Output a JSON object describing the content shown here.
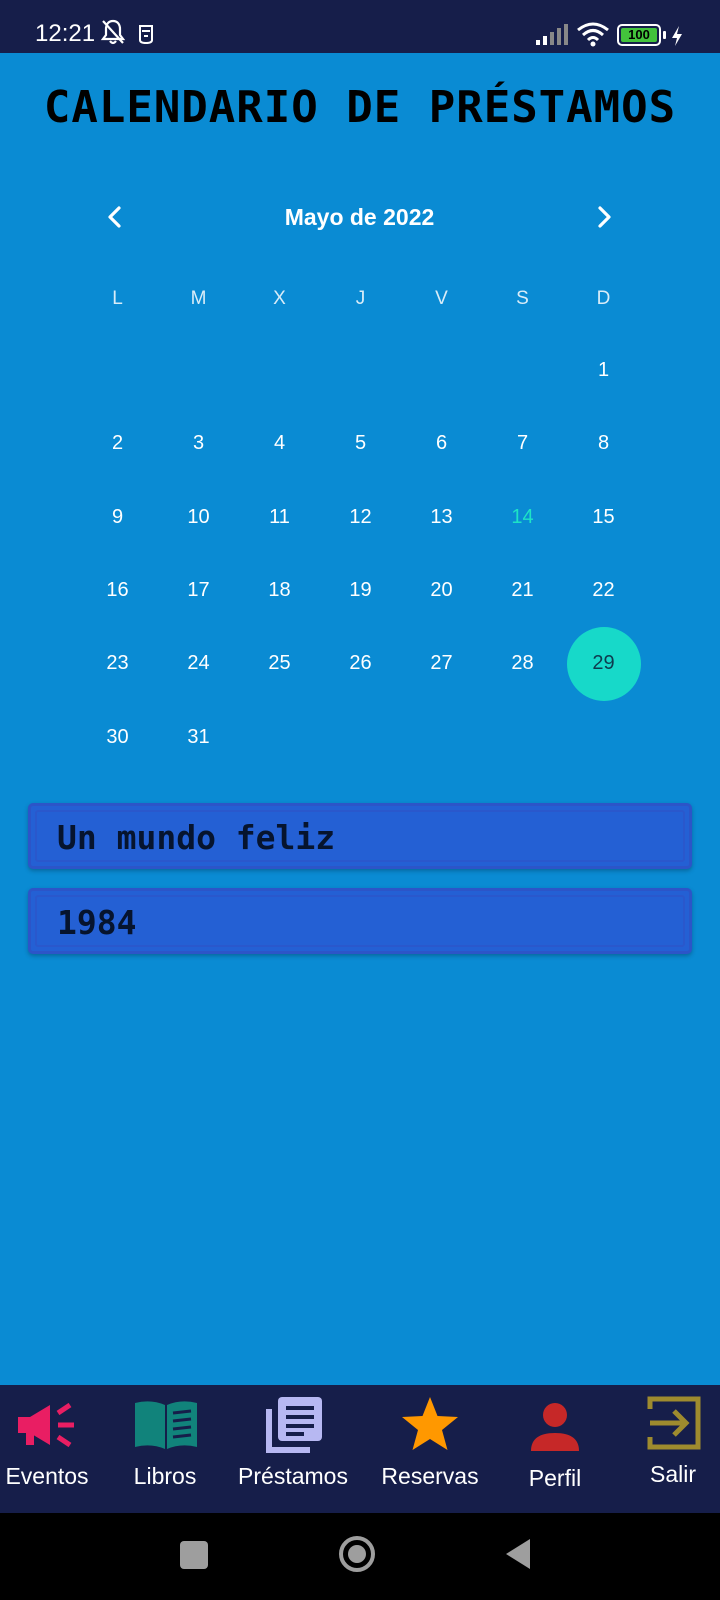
{
  "status_bar": {
    "time": "12:21",
    "battery_level": "100",
    "icons": [
      "bell-off-icon",
      "alarm-icon",
      "signal-icon",
      "wifi-icon",
      "battery-icon",
      "charging-icon"
    ]
  },
  "page": {
    "title": "CALENDARIO DE PRÉSTAMOS"
  },
  "calendar": {
    "month_label": "Mayo de 2022",
    "prev_icon": "chevron-left-icon",
    "next_icon": "chevron-right-icon",
    "weekdays": [
      "L",
      "M",
      "X",
      "J",
      "V",
      "S",
      "D"
    ],
    "leading_blanks": 6,
    "days": [
      "1",
      "2",
      "3",
      "4",
      "5",
      "6",
      "7",
      "8",
      "9",
      "10",
      "11",
      "12",
      "13",
      "14",
      "15",
      "16",
      "17",
      "18",
      "19",
      "20",
      "21",
      "22",
      "23",
      "24",
      "25",
      "26",
      "27",
      "28",
      "29",
      "30",
      "31"
    ],
    "today": "14",
    "selected": "29",
    "colors": {
      "today": "#1de3c6",
      "selected_bg": "#17d9c9"
    }
  },
  "loans": [
    {
      "title": "Un mundo feliz"
    },
    {
      "title": "1984"
    }
  ],
  "bottom_nav": {
    "items": [
      {
        "label": "Eventos",
        "icon": "megaphone-icon",
        "color": "#e91e63"
      },
      {
        "label": "Libros",
        "icon": "book-icon",
        "color": "#11837b"
      },
      {
        "label": "Préstamos",
        "icon": "library-books-icon",
        "color": "#b7b8f2"
      },
      {
        "label": "Reservas",
        "icon": "star-icon",
        "color": "#ff9800"
      },
      {
        "label": "Perfil",
        "icon": "person-icon",
        "color": "#c62828"
      },
      {
        "label": "Salir",
        "icon": "exit-icon",
        "color": "#9e8b2e"
      }
    ]
  },
  "system_nav": {
    "icons": [
      "recents-icon",
      "home-icon",
      "back-icon"
    ]
  },
  "colors": {
    "background": "#0a8bd3",
    "bars": "#161e4a",
    "card": "#2460d4"
  }
}
